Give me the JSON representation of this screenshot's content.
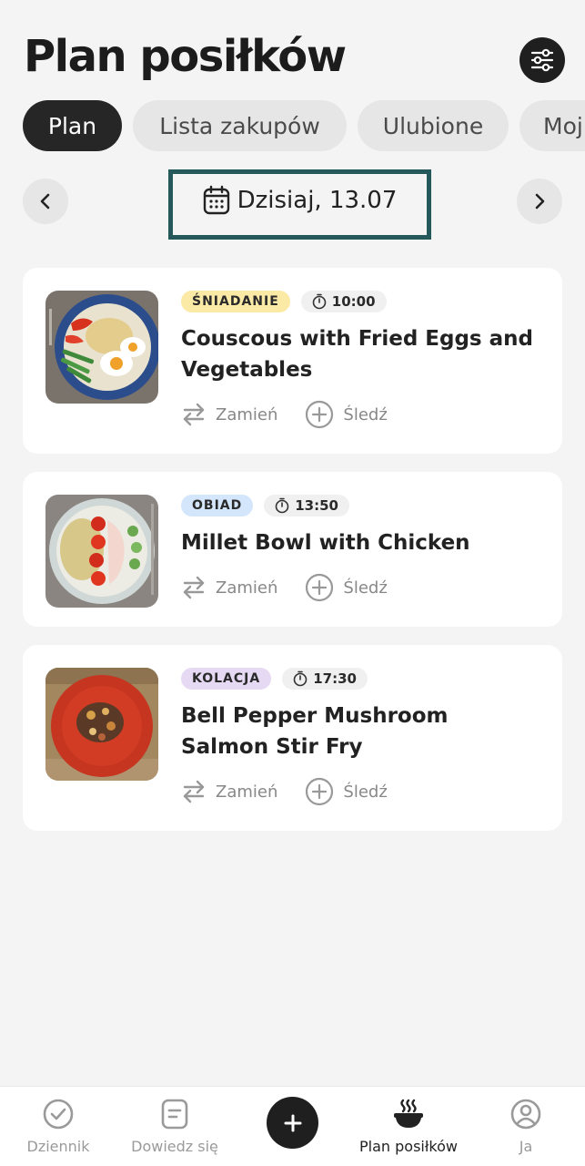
{
  "header": {
    "title": "Plan posiłków",
    "filter_icon": "sliders-icon"
  },
  "tabs": [
    {
      "label": "Plan",
      "active": true
    },
    {
      "label": "Lista zakupów",
      "active": false
    },
    {
      "label": "Ulubione",
      "active": false
    },
    {
      "label": "Moj",
      "active": false
    }
  ],
  "date_nav": {
    "label": "Dzisiaj, 13.07"
  },
  "meals": [
    {
      "category": "ŚNIADANIE",
      "category_color": "#fbe9a6",
      "time": "10:00",
      "title": "Couscous with Fried Eggs and Vegetables",
      "swap_label": "Zamień",
      "track_label": "Śledź"
    },
    {
      "category": "OBIAD",
      "category_color": "#d3e6fb",
      "time": "13:50",
      "title": "Millet Bowl with Chicken",
      "swap_label": "Zamień",
      "track_label": "Śledź"
    },
    {
      "category": "KOLACJA",
      "category_color": "#e6d9f3",
      "time": "17:30",
      "title": "Bell Pepper Mushroom Salmon Stir Fry",
      "swap_label": "Zamień",
      "track_label": "Śledź"
    }
  ],
  "bottom_nav": [
    {
      "label": "Dziennik",
      "icon": "check-circle-icon",
      "active": false
    },
    {
      "label": "Dowiedz się",
      "icon": "article-icon",
      "active": false
    },
    {
      "label": "Plan posiłków",
      "icon": "bowl-icon",
      "active": true
    },
    {
      "label": "Ja",
      "icon": "profile-icon",
      "active": false
    }
  ],
  "colors": {
    "accent": "#1f1f1f",
    "date_box_border": "#25585a"
  }
}
